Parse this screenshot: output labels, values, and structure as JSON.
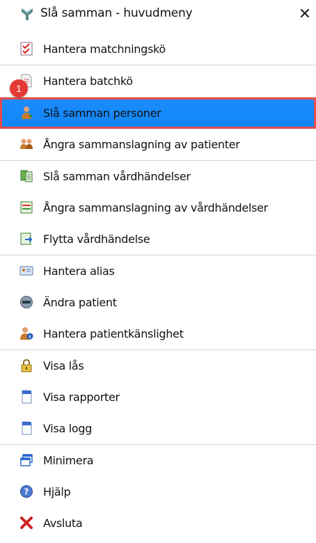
{
  "window": {
    "title": "Slå samman - huvudmeny",
    "close_label": "✕"
  },
  "annotation": {
    "badge_number": "1"
  },
  "colors": {
    "selected_bg": "#1a8cff",
    "highlight_border": "#e74c4c",
    "badge": "#e53935"
  },
  "menu": {
    "items": [
      {
        "label": "Hantera matchningskö",
        "icon": "checklist-icon"
      },
      {
        "label": "Hantera batchkö",
        "icon": "document-list-icon"
      },
      {
        "label": "Slå samman personer",
        "icon": "merge-persons-icon",
        "selected": true
      },
      {
        "label": "Ångra sammanslagning av patienter",
        "icon": "undo-merge-patients-icon"
      },
      {
        "label": "Slå samman vårdhändelser",
        "icon": "merge-records-icon"
      },
      {
        "label": "Ångra sammanslagning av vårdhändelser",
        "icon": "undo-merge-records-icon"
      },
      {
        "label": "Flytta vårdhändelse",
        "icon": "move-record-icon"
      },
      {
        "label": "Hantera alias",
        "icon": "alias-card-icon"
      },
      {
        "label": "Ändra patient",
        "icon": "edit-patient-icon"
      },
      {
        "label": "Hantera patientkänslighet",
        "icon": "patient-sensitivity-icon"
      },
      {
        "label": "Visa lås",
        "icon": "lock-icon"
      },
      {
        "label": "Visa rapporter",
        "icon": "report-document-icon"
      },
      {
        "label": "Visa logg",
        "icon": "log-document-icon"
      },
      {
        "label": "Minimera",
        "icon": "minimize-window-icon"
      },
      {
        "label": "Hjälp",
        "icon": "help-icon"
      },
      {
        "label": "Avsluta",
        "icon": "exit-icon"
      }
    ]
  }
}
